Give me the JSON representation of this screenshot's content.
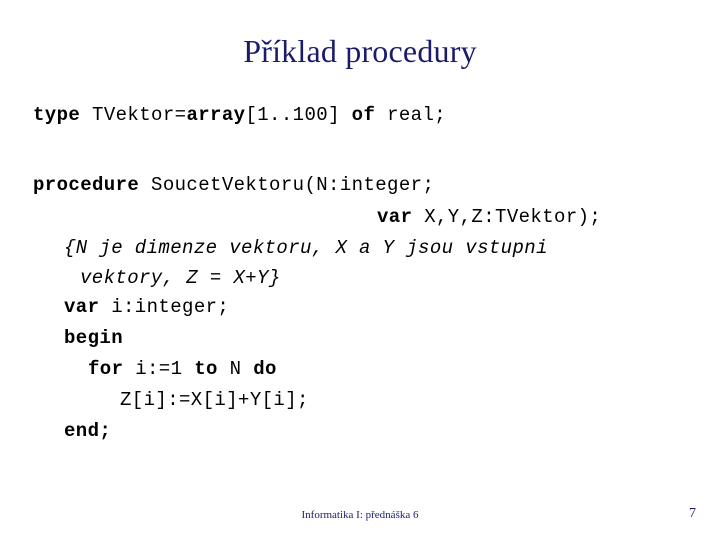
{
  "slide": {
    "title": "Příklad procedury",
    "background_color": "#ffffff",
    "accent_color": "#1b1b6e",
    "code_color": "#000000"
  },
  "code": {
    "line_type": {
      "kw_type": "type",
      "name": " TVektor=",
      "kw_array": "array",
      "range": "[1..100] ",
      "kw_of": "of",
      "tail": " real;"
    },
    "line_procedure": {
      "kw_procedure": "procedure",
      "signature": " SoucetVektoru(N:integer;"
    },
    "line_var_params": {
      "kw_var": "var",
      "params": " X,Y,Z:TVektor);"
    },
    "line_comment_1": "{N je dimenze vektoru, X a Y jsou vstupni",
    "line_comment_2": "vektory, Z = X+Y}",
    "line_var_local": {
      "kw_var": "var",
      "decl": " i:integer;"
    },
    "line_begin": "begin",
    "line_for": {
      "kw_for": "for",
      "counter": " i:=1 ",
      "kw_to": "to",
      "limit": " N ",
      "kw_do": "do"
    },
    "line_assign": "Z[i]:=X[i]+Y[i];",
    "line_end": "end;"
  },
  "footer": {
    "note": "Informatika I: přednáška 6",
    "page_number": "7"
  }
}
